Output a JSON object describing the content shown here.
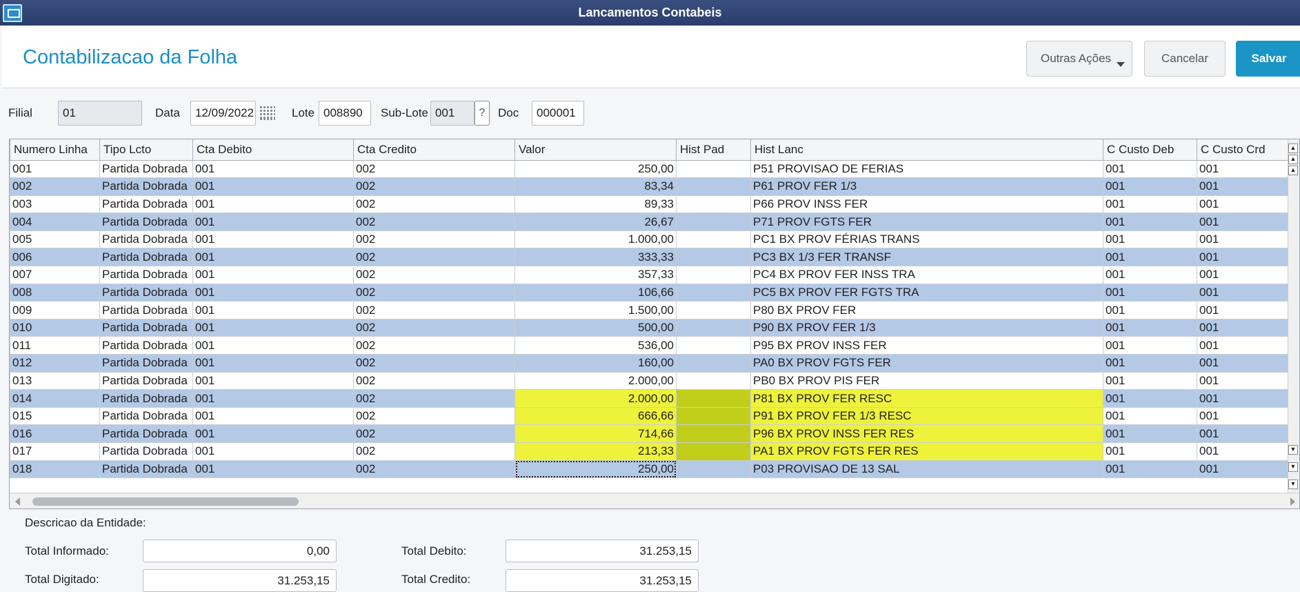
{
  "window": {
    "title": "Lancamentos Contabeis"
  },
  "header": {
    "title": "Contabilizacao da Folha",
    "outras_acoes": "Outras Ações",
    "cancelar": "Cancelar",
    "salvar": "Salvar"
  },
  "form": {
    "filial_label": "Filial",
    "filial": "01",
    "data_label": "Data",
    "data": "12/09/2022",
    "lote_label": "Lote",
    "lote": "008890",
    "sublote_label": "Sub-Lote",
    "sublote": "001",
    "help": "?",
    "doc_label": "Doc",
    "doc": "000001"
  },
  "grid": {
    "columns": [
      "Numero Linha",
      "Tipo Lcto",
      "Cta Debito",
      "Cta Credito",
      "Valor",
      "Hist Pad",
      "Hist Lanc",
      "C Custo Deb",
      "C Custo Crd"
    ],
    "rows": [
      [
        "001",
        "Partida Dobrada",
        "001",
        "002",
        "250,00",
        "",
        "P51 PROVISAO DE FERIAS",
        "001",
        "001"
      ],
      [
        "002",
        "Partida Dobrada",
        "001",
        "002",
        "83,34",
        "",
        "P61 PROV FER 1/3",
        "001",
        "001"
      ],
      [
        "003",
        "Partida Dobrada",
        "001",
        "002",
        "89,33",
        "",
        "P66 PROV INSS FER",
        "001",
        "001"
      ],
      [
        "004",
        "Partida Dobrada",
        "001",
        "002",
        "26,67",
        "",
        "P71 PROV FGTS FER",
        "001",
        "001"
      ],
      [
        "005",
        "Partida Dobrada",
        "001",
        "002",
        "1.000,00",
        "",
        "PC1 BX PROV FÉRIAS TRANS",
        "001",
        "001"
      ],
      [
        "006",
        "Partida Dobrada",
        "001",
        "002",
        "333,33",
        "",
        "PC3 BX 1/3 FER TRANSF",
        "001",
        "001"
      ],
      [
        "007",
        "Partida Dobrada",
        "001",
        "002",
        "357,33",
        "",
        "PC4 BX PROV FER INSS TRA",
        "001",
        "001"
      ],
      [
        "008",
        "Partida Dobrada",
        "001",
        "002",
        "106,66",
        "",
        "PC5 BX PROV FER FGTS TRA",
        "001",
        "001"
      ],
      [
        "009",
        "Partida Dobrada",
        "001",
        "002",
        "1.500,00",
        "",
        "P80 BX PROV FER",
        "001",
        "001"
      ],
      [
        "010",
        "Partida Dobrada",
        "001",
        "002",
        "500,00",
        "",
        "P90 BX PROV FER 1/3",
        "001",
        "001"
      ],
      [
        "011",
        "Partida Dobrada",
        "001",
        "002",
        "536,00",
        "",
        "P95 BX PROV INSS FER",
        "001",
        "001"
      ],
      [
        "012",
        "Partida Dobrada",
        "001",
        "002",
        "160,00",
        "",
        "PA0 BX PROV FGTS FER",
        "001",
        "001"
      ],
      [
        "013",
        "Partida Dobrada",
        "001",
        "002",
        "2.000,00",
        "",
        "PB0 BX PROV PIS FER",
        "001",
        "001"
      ],
      [
        "014",
        "Partida Dobrada",
        "001",
        "002",
        "2.000,00",
        "",
        "P81 BX PROV FER RESC",
        "001",
        "001"
      ],
      [
        "015",
        "Partida Dobrada",
        "001",
        "002",
        "666,66",
        "",
        "P91 BX PROV FER 1/3 RESC",
        "001",
        "001"
      ],
      [
        "016",
        "Partida Dobrada",
        "001",
        "002",
        "714,66",
        "",
        "P96 BX PROV INSS FER RES",
        "001",
        "001"
      ],
      [
        "017",
        "Partida Dobrada",
        "001",
        "002",
        "213,33",
        "",
        "PA1 BX PROV FGTS FER RES",
        "001",
        "001"
      ],
      [
        "018",
        "Partida Dobrada",
        "001",
        "002",
        "250,00",
        "",
        "P03 PROVISAO DE 13 SAL",
        "001",
        "001"
      ]
    ],
    "highlighted_rows": [
      "014",
      "015",
      "016",
      "017"
    ],
    "highlight_color": "#eef23a",
    "selected_row_color": "#b3c9e6"
  },
  "footer": {
    "descricao_label": "Descricao da Entidade:",
    "total_informado_label": "Total Informado:",
    "total_informado": "0,00",
    "total_debito_label": "Total Debito:",
    "total_debito": "31.253,15",
    "total_digitado_label": "Total Digitado:",
    "total_digitado": "31.253,15",
    "total_credito_label": "Total Credito:",
    "total_credito": "31.253,15"
  },
  "colors": {
    "accent": "#1b94c6",
    "title": "#1a8ec6",
    "titlebar": "#2f4373"
  }
}
